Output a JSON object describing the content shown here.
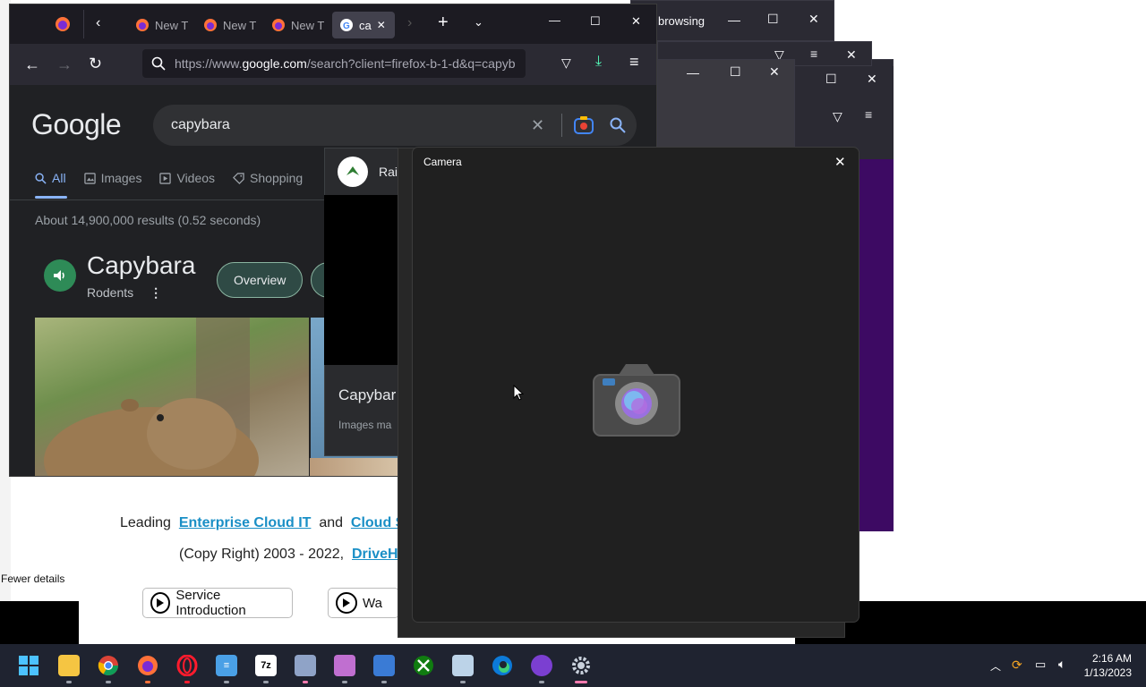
{
  "background": {
    "task_manager": {
      "fewer_details": "Fewer details"
    },
    "back_window": {
      "title_fragment": "browsing"
    },
    "drivehq": {
      "line1_prefix": "Leading",
      "line1_link1": "Enterprise Cloud IT",
      "line1_mid": "and",
      "line1_link2": "Cloud Sur",
      "line2_prefix": "(Copy Right) 2003 - 2022,",
      "line2_link": "DriveHQ",
      "button1": "Service Introduction",
      "button2": "Wa"
    }
  },
  "firefox": {
    "tabs": [
      {
        "label": "",
        "icon": "firefox-icon"
      },
      {
        "label": "New T",
        "icon": "firefox-icon"
      },
      {
        "label": "New T",
        "icon": "firefox-icon"
      },
      {
        "label": "New T",
        "icon": "firefox-icon"
      },
      {
        "label": "ca",
        "icon": "google-icon",
        "active": true
      }
    ],
    "url": {
      "prefix": "https://www.",
      "domain": "google.com",
      "rest": "/search?client=firefox-b-1-d&q=capyb"
    }
  },
  "google": {
    "logo": "Google",
    "query": "capybara",
    "tabs": [
      "All",
      "Images",
      "Videos",
      "Shopping"
    ],
    "active_tab": "All",
    "results_stats": "About 14,900,000 results (0.52 seconds)",
    "knowledge_panel": {
      "title": "Capybara",
      "subtitle": "Rodents",
      "pill": "Overview"
    }
  },
  "overlay_card": {
    "header": "Rai",
    "title": "Capybar",
    "subtitle": "Images ma"
  },
  "camera": {
    "title": "Camera"
  },
  "taskbar": {
    "apps": [
      "start-icon",
      "file-explorer-icon",
      "chrome-icon",
      "firefox-icon",
      "opera-icon",
      "notepad-icon",
      "7zip-icon",
      "photos-icon",
      "app-icon",
      "app2-icon",
      "xbox-icon",
      "resource-monitor-icon",
      "edge-icon",
      "game-app-icon",
      "settings-icon"
    ],
    "clock": {
      "time": "2:16 AM",
      "date": "1/13/2023"
    }
  },
  "colors": {
    "google_blue": "#8ab4f8",
    "firefox_dark": "#2b2a33",
    "camera_bg": "#202020",
    "taskbar": "#1f2330",
    "purple": "#3d0a63"
  }
}
